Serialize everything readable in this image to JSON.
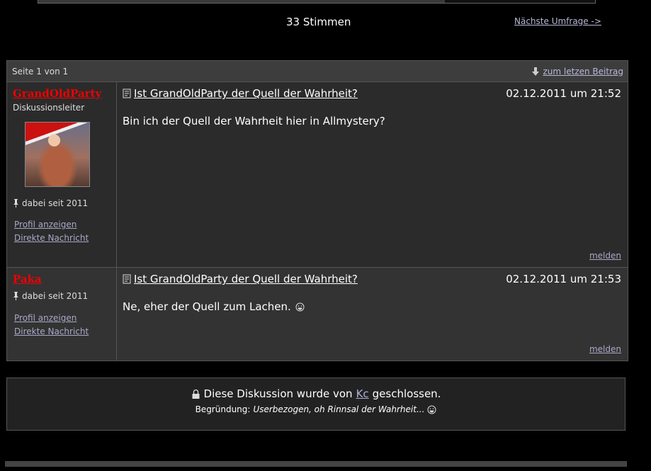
{
  "poll": {
    "votes_label": "33 Stimmen",
    "next_poll_label": "Nächste Umfrage ->",
    "fill": 0.73
  },
  "thread": {
    "pager": {
      "page_info": "Seite 1 von 1",
      "last_post_label": "zum letzen Beitrag"
    },
    "posts": [
      {
        "user": "GrandOldParty",
        "role": "Diskussionsleiter",
        "since": "dabei seit 2011",
        "profile_label": "Profil anzeigen",
        "message_label": "Direkte Nachricht",
        "title": "Ist GrandOldParty der Quell der Wahrheit?",
        "date": "02.12.2011 um 21:52",
        "body": "Bin ich der Quell der Wahrheit hier in Allmystery?",
        "report_label": "melden"
      },
      {
        "user": "Paka",
        "since": "dabei seit 2011",
        "profile_label": "Profil anzeigen",
        "message_label": "Direkte Nachricht",
        "title": "Ist GrandOldParty der Quell der Wahrheit?",
        "date": "02.12.2011 um 21:53",
        "body": "Ne, eher der Quell zum Lachen.",
        "report_label": "melden"
      }
    ]
  },
  "closed_notice": {
    "prefix": "Diese Diskussion wurde von",
    "closed_by": "Kc",
    "suffix": "geschlossen.",
    "reason_label": "Begründung:",
    "reason": "Userbezogen, oh Rinnsal der Wahrheit..."
  },
  "colors": {
    "background": "#000000",
    "username": "#ee0000",
    "link": "#b0b0d0",
    "panel": "#333333"
  },
  "icons": [
    "arrow-down-icon",
    "document-icon",
    "pin-icon",
    "smiley-icon",
    "lock-icon"
  ]
}
